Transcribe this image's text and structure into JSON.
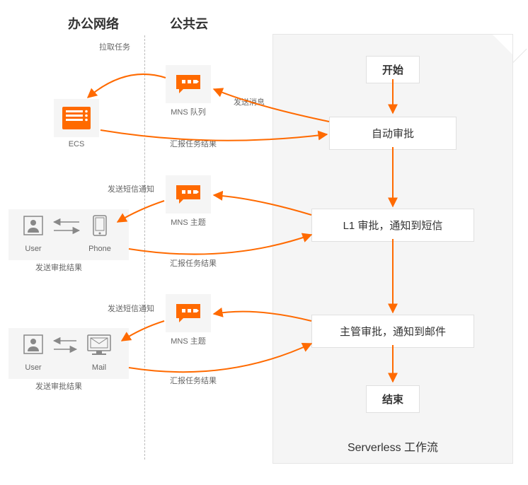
{
  "sections": {
    "office": "办公网络",
    "cloud": "公共云"
  },
  "workflow": {
    "title": "Serverless 工作流",
    "steps": {
      "start": "开始",
      "auto_approve": "自动审批",
      "l1_approve": "L1 审批，通知到短信",
      "mgr_approve": "主管审批，通知到邮件",
      "end": "结束"
    }
  },
  "nodes": {
    "ecs": "ECS",
    "mns_queue": "MNS 队列",
    "mns_topic_1": "MNS 主题",
    "mns_topic_2": "MNS 主题",
    "user": "User",
    "phone": "Phone",
    "mail": "Mail"
  },
  "edges": {
    "poll_task": "拉取任务",
    "send_msg": "发送消息",
    "report_result": "汇报任务结果",
    "send_sms": "发送短信通知",
    "send_approval_result": "发送审批结果"
  }
}
